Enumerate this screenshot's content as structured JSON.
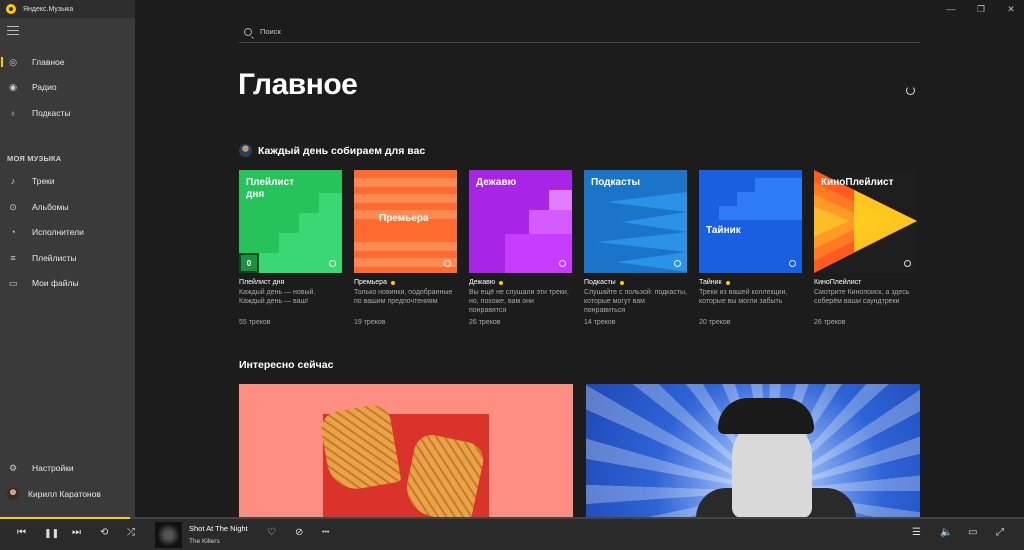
{
  "app": {
    "title": "Яндекс.Музыка"
  },
  "window": {
    "minimize": "—",
    "restore": "❐",
    "close": "✕"
  },
  "sidebar": {
    "items": [
      {
        "label": "Главное",
        "icon": "home-icon",
        "glyph": "◎"
      },
      {
        "label": "Радио",
        "icon": "radio-icon",
        "glyph": "◉"
      },
      {
        "label": "Подкасты",
        "icon": "microphone-icon",
        "glyph": "♁"
      }
    ],
    "section_title": "МОЯ МУЗЫКА",
    "my_music": [
      {
        "label": "Треки",
        "icon": "music-note-icon",
        "glyph": "♪"
      },
      {
        "label": "Альбомы",
        "icon": "album-icon",
        "glyph": "⊙"
      },
      {
        "label": "Исполнители",
        "icon": "artist-icon",
        "glyph": "◔"
      },
      {
        "label": "Плейлисты",
        "icon": "playlist-icon",
        "glyph": "≡"
      },
      {
        "label": "Мои файлы",
        "icon": "folder-icon",
        "glyph": "▭"
      }
    ],
    "settings": {
      "label": "Настройки",
      "glyph": "⚙"
    },
    "user": {
      "label": "Кирилл Каратонов"
    }
  },
  "search": {
    "placeholder": "Поиск"
  },
  "main": {
    "title": "Главное",
    "daily_section": "Каждый день собираем для вас",
    "cards": [
      {
        "cover_title": "Плейлист\nдня",
        "name": "Плейлист дня",
        "dot": false,
        "desc": "Каждый день — новый. Каждый день — ваш!",
        "count": "55 треков",
        "zero": "0"
      },
      {
        "cover_title": "Премьера",
        "name": "Премьера",
        "dot": true,
        "desc": "Только новинки, подобранные по вашим предпочтениям",
        "count": "19 треков"
      },
      {
        "cover_title": "Дежавю",
        "name": "Дежавю",
        "dot": true,
        "desc": "Вы ещё не слушали эти треки, но, похоже, вам они понравятся",
        "count": "26 треков"
      },
      {
        "cover_title": "Подкасты",
        "name": "Подкасты",
        "dot": true,
        "desc": "Слушайте с пользой: подкасты, которые могут вам понравиться",
        "count": "14 треков"
      },
      {
        "cover_title": "Тайник",
        "name": "Тайник",
        "dot": true,
        "desc": "Треки из вашей коллекции, которые вы могли забыть",
        "count": "20 треков"
      },
      {
        "cover_title": "КиноПлейлист",
        "name": "КиноПлейлист",
        "dot": false,
        "desc": "Смотрите Кинопоиск, а здесь соберём ваши саундтреки",
        "count": "26 треков"
      }
    ],
    "interesting_section": "Интересно сейчас"
  },
  "player": {
    "track": "Shot At The Night",
    "artist": "The Killers",
    "progress": 0.127,
    "controls": {
      "prev": "⏮",
      "pause": "❚❚",
      "next": "⏭",
      "repeat": "⟲",
      "shuffle": "⤮",
      "like": "♡",
      "dislike": "⊘",
      "more": "•••",
      "queue": "☰",
      "volume": "🔈",
      "miniplayer": "▭",
      "fullscreen": "⤢"
    }
  }
}
